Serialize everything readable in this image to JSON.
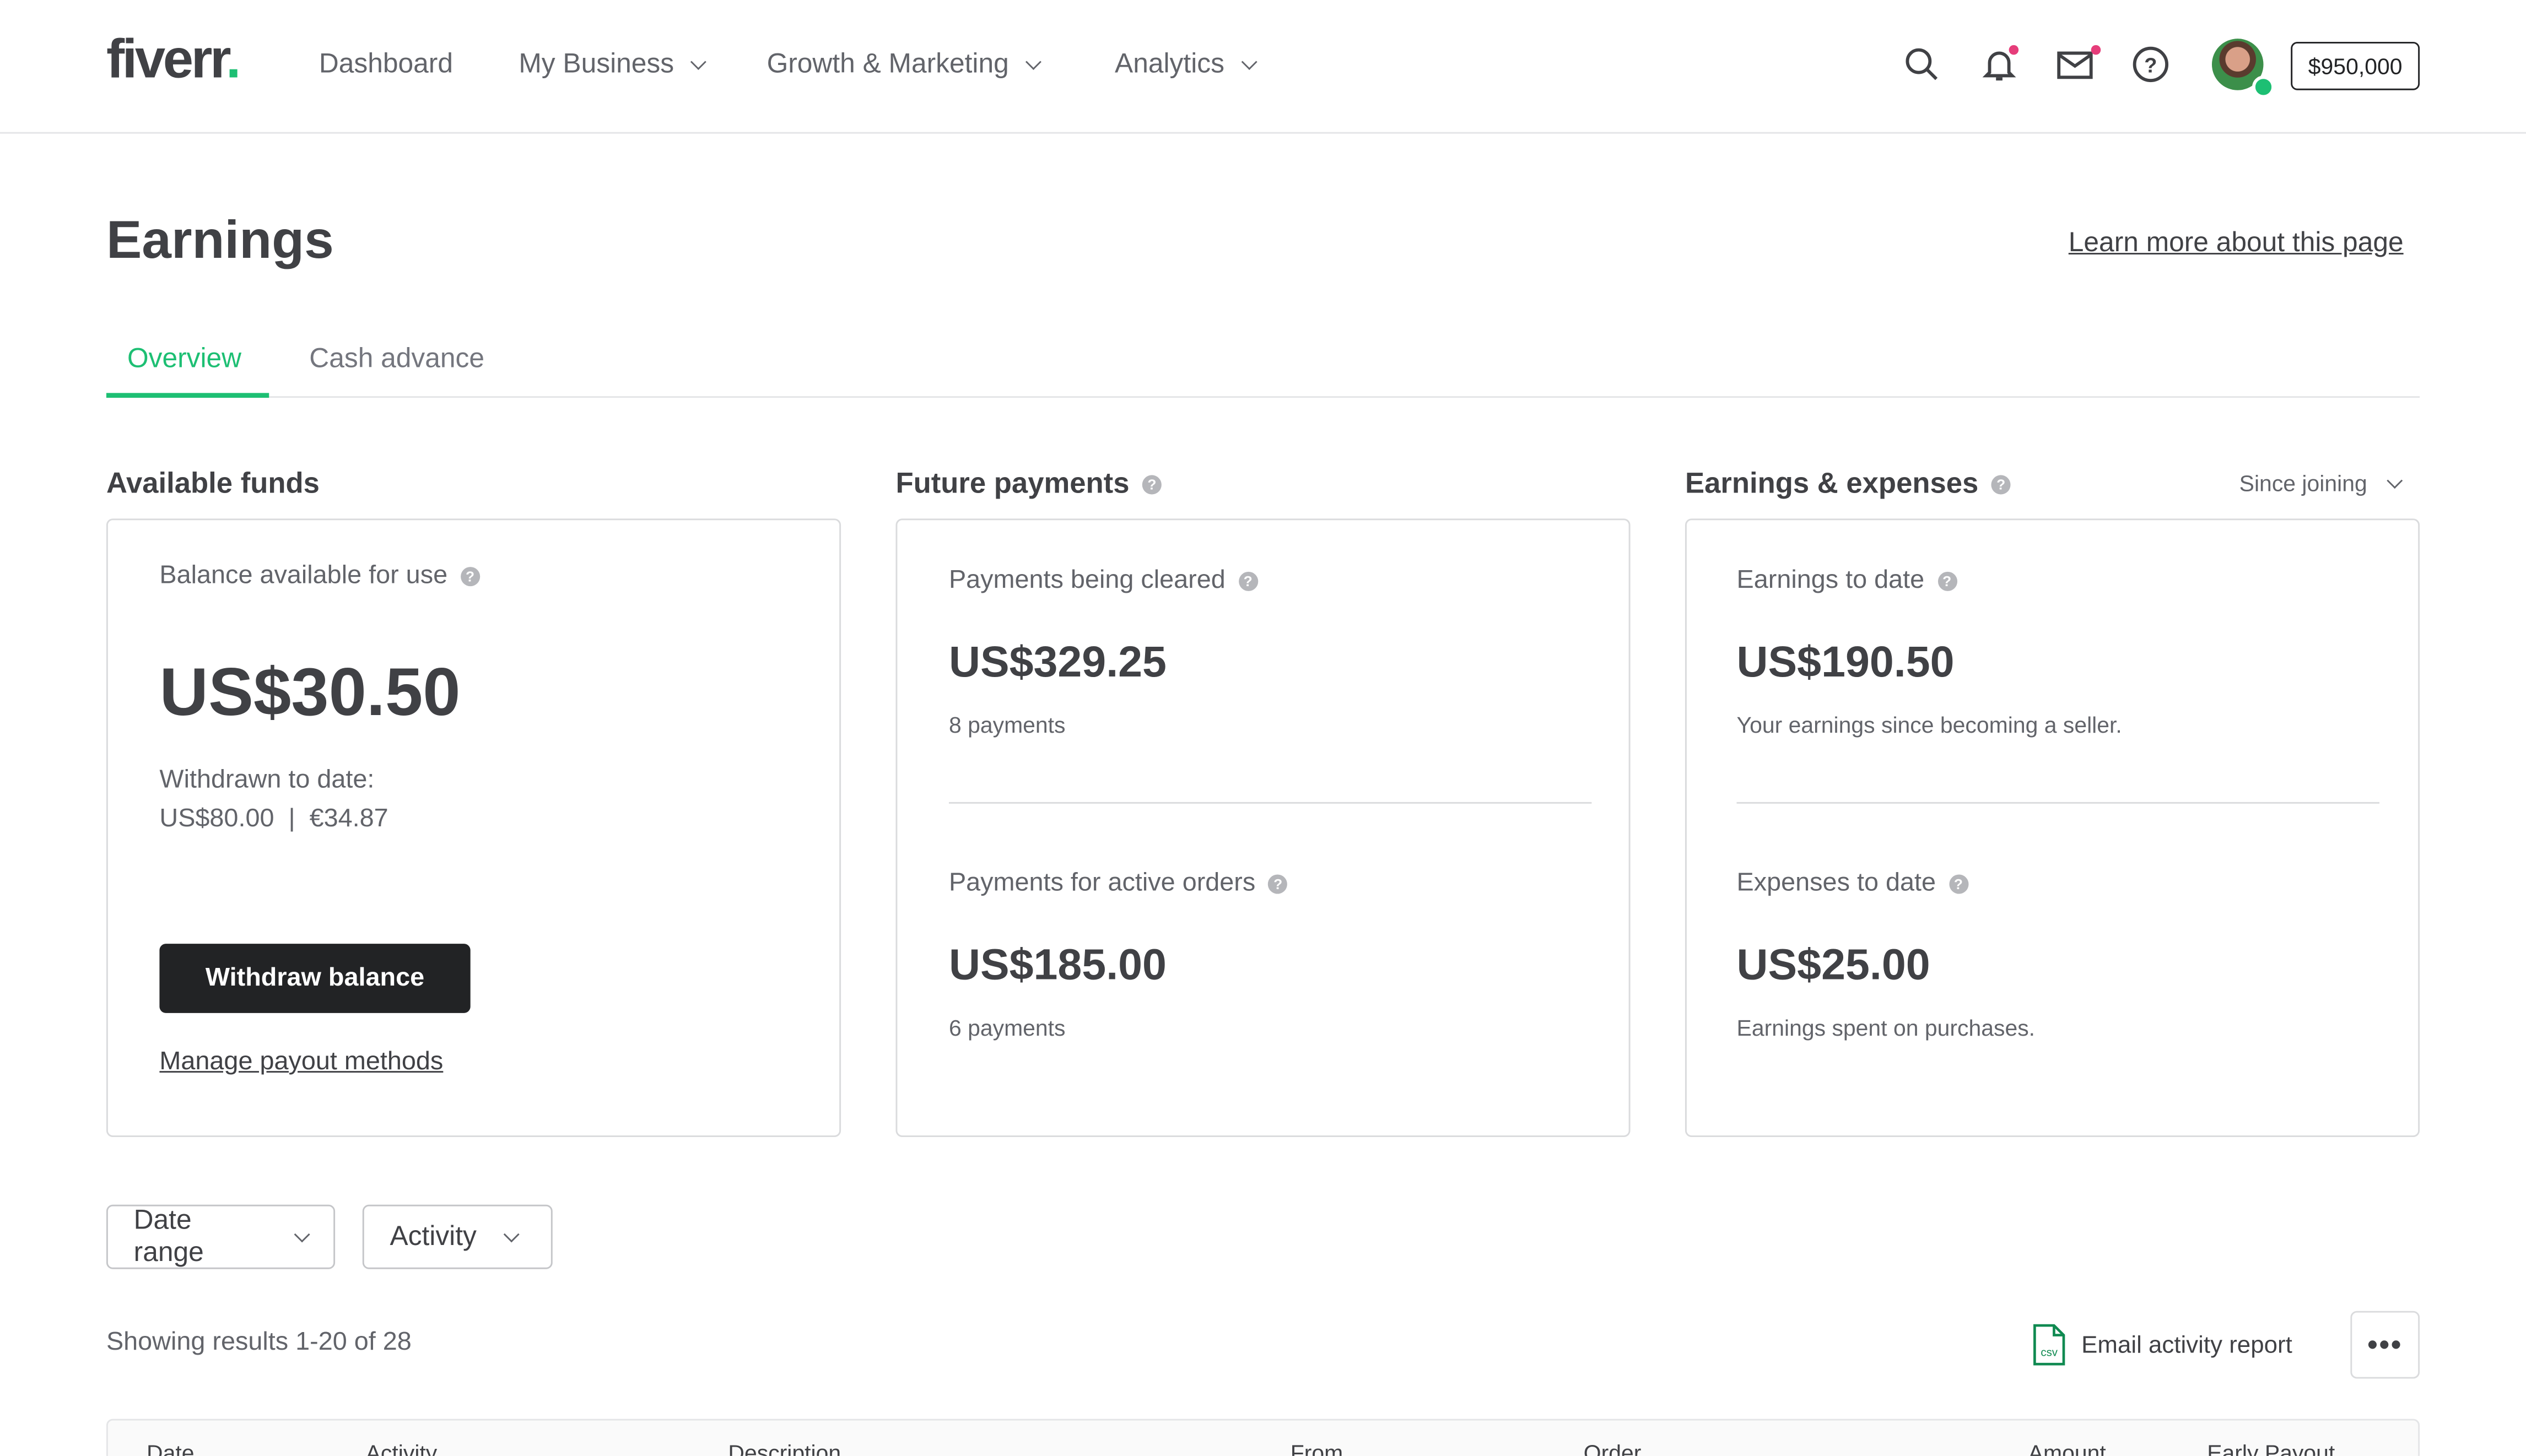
{
  "header": {
    "logo": "fiverr",
    "logo_dot": ".",
    "nav": [
      {
        "label": "Dashboard",
        "dropdown": false
      },
      {
        "label": "My Business",
        "dropdown": true
      },
      {
        "label": "Growth & Marketing",
        "dropdown": true
      },
      {
        "label": "Analytics",
        "dropdown": true
      }
    ],
    "icons": [
      "search-icon",
      "bell-icon",
      "mail-icon",
      "help-icon"
    ],
    "balance": "$950,000"
  },
  "page": {
    "title": "Earnings",
    "learn_more": "Learn more about this page",
    "tabs": [
      {
        "label": "Overview",
        "active": true
      },
      {
        "label": "Cash advance",
        "active": false
      }
    ]
  },
  "available": {
    "title": "Available funds",
    "balance_label": "Balance available for use",
    "balance": "US$30.50",
    "withdrawn_label": "Withdrawn to date:",
    "withdrawn_value": "US$80.00  |  €34.87",
    "withdraw_button": "Withdraw balance",
    "manage_link": "Manage payout methods"
  },
  "future": {
    "title": "Future payments",
    "cleared_label": "Payments being cleared",
    "cleared_value": "US$329.25",
    "cleared_count": "8 payments",
    "active_label": "Payments for active orders",
    "active_value": "US$185.00",
    "active_count": "6 payments"
  },
  "earnings": {
    "title": "Earnings & expenses",
    "range": "Since joining",
    "earn_label": "Earnings to date",
    "earn_value": "US$190.50",
    "earn_sub": "Your earnings since becoming a seller.",
    "exp_label": "Expenses to date",
    "exp_value": "US$25.00",
    "exp_sub": "Earnings spent on purchases."
  },
  "filters": {
    "date_range": "Date range",
    "activity": "Activity"
  },
  "results": {
    "text": "Showing results 1-20 of 28",
    "email_report": "Email activity report",
    "csv_icon_text": "csv",
    "more": "•••"
  },
  "table": {
    "columns": [
      "Date",
      "Activity",
      "Description",
      "From",
      "Order",
      "Amount",
      "Early Payout"
    ]
  },
  "colors": {
    "brand": "#1dbf73",
    "text": "#404145",
    "button": "#222325",
    "notification": "#e63d7a"
  }
}
